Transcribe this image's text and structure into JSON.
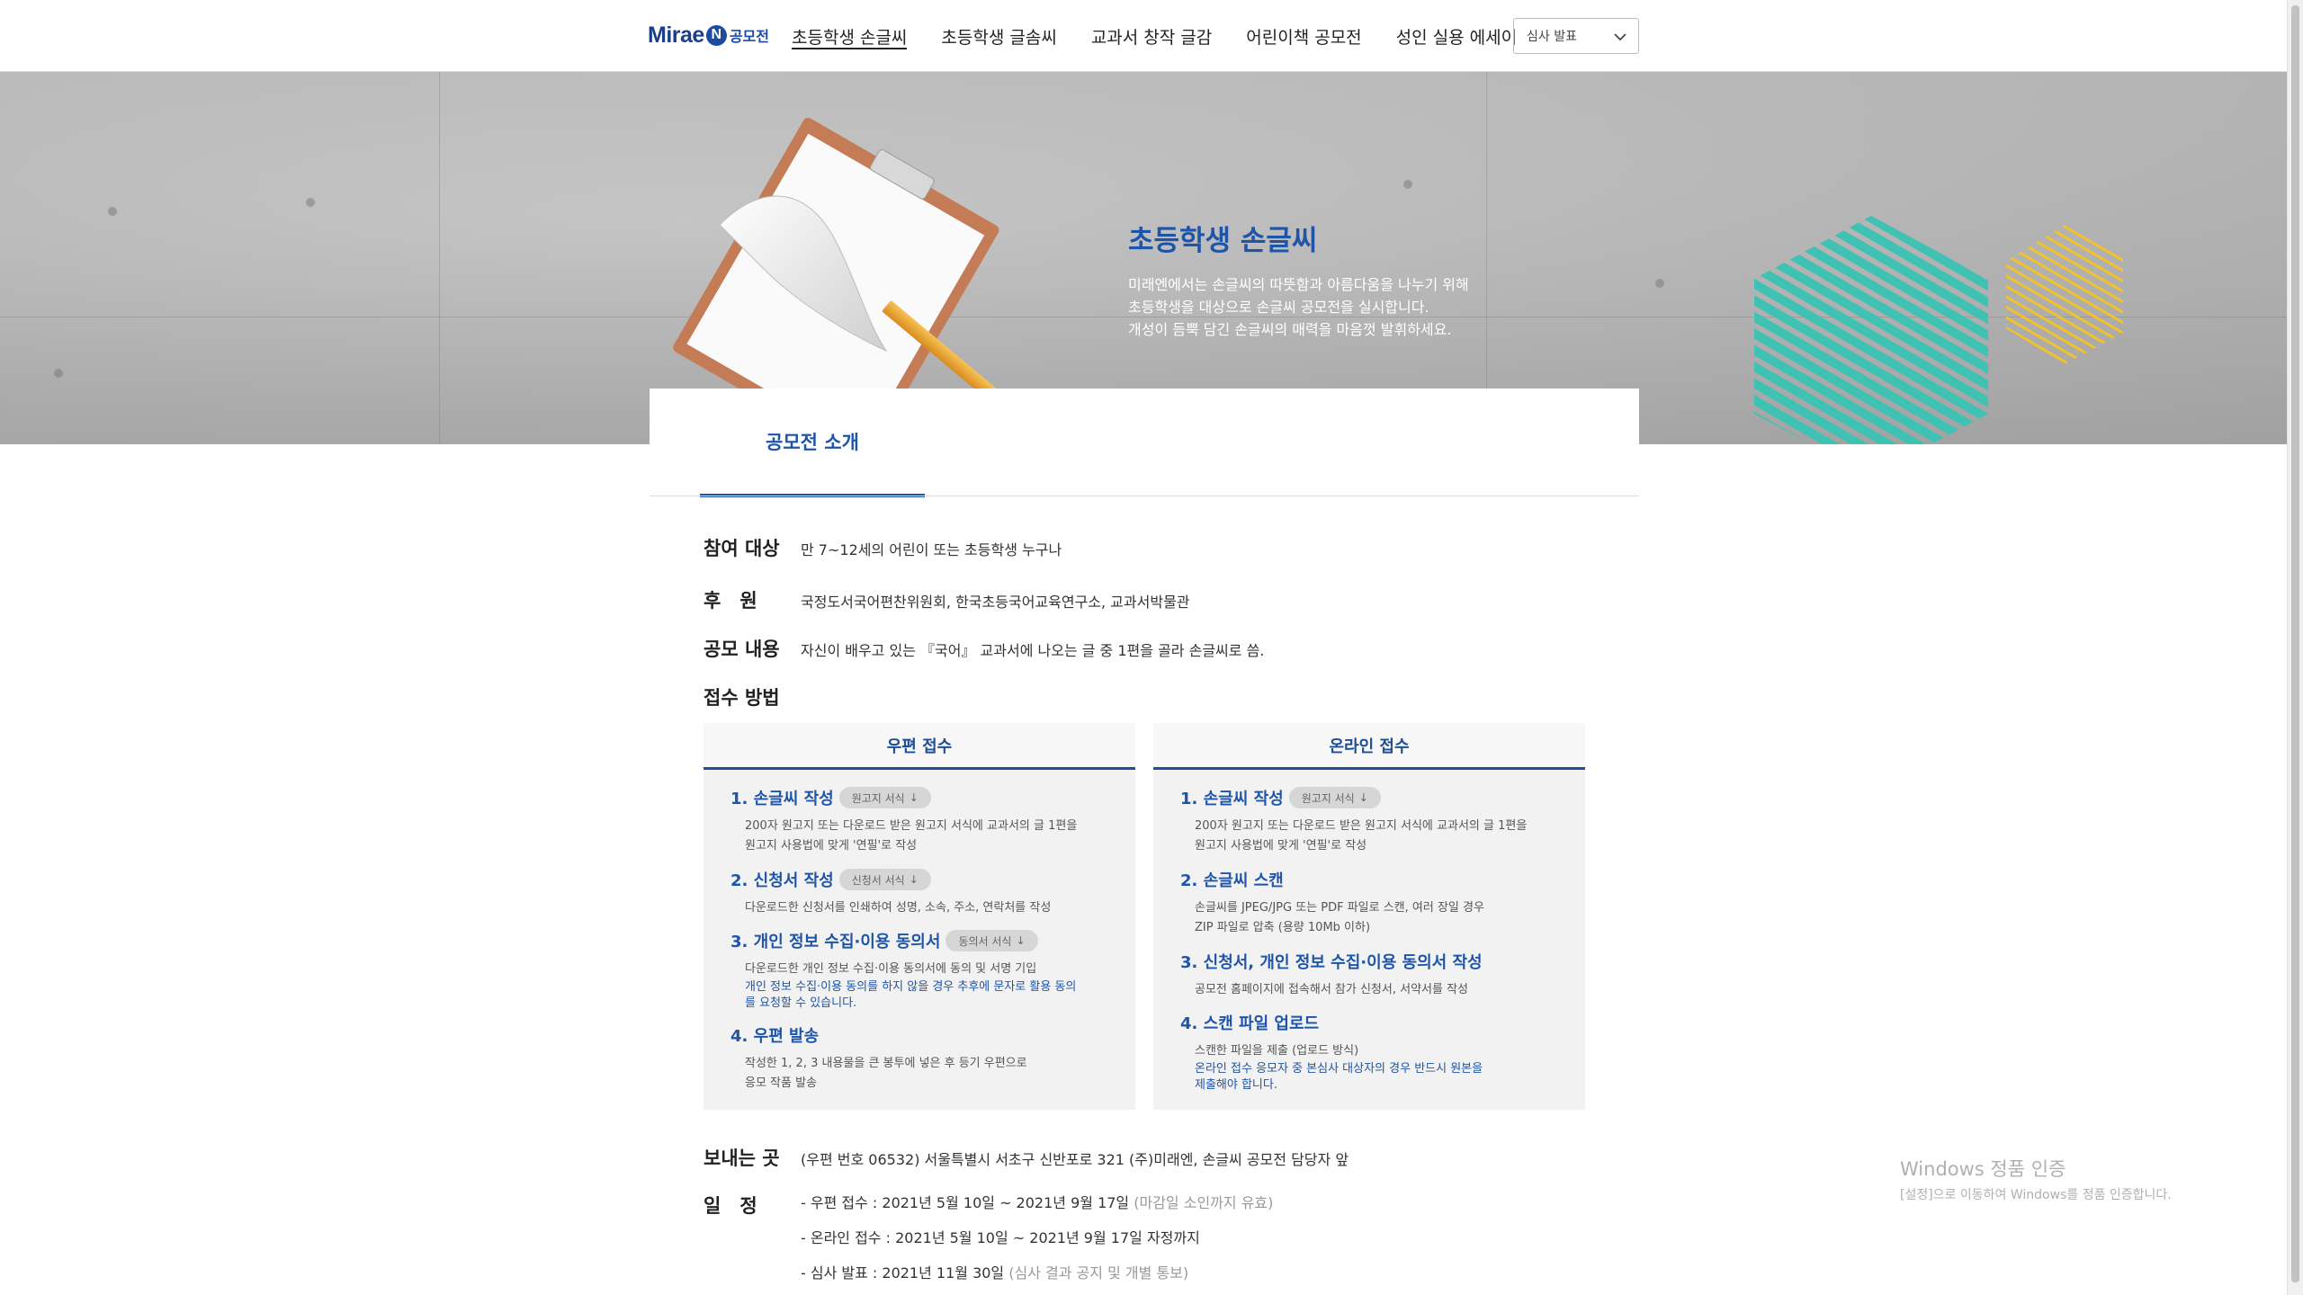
{
  "header": {
    "logo_word": "Mirae",
    "logo_mark": "N",
    "logo_suffix": "공모전",
    "nav": [
      {
        "label": "초등학생 손글씨",
        "active": true
      },
      {
        "label": "초등학생 글솜씨",
        "active": false
      },
      {
        "label": "교과서 창작 글감",
        "active": false
      },
      {
        "label": "어린이책 공모전",
        "active": false
      },
      {
        "label": "성인 실용 에세이",
        "active": false
      }
    ],
    "select_value": "심사 발표",
    "select_icon": "chevron-down-icon"
  },
  "banner": {
    "title": "초등학생 손글씨",
    "desc": [
      "미래엔에서는 손글씨의 따뜻함과 아름다움을 나누기 위해",
      "초등학생을 대상으로 손글씨 공모전을 실시합니다.",
      "개성이 듬뿍 담긴 손글씨의 매력을 마음껏 발휘하세요."
    ],
    "colors": {
      "title": "#1f55a8",
      "teal": "#3fc2b4",
      "yellow": "#f2c22d",
      "navy": "#3c4fa5"
    }
  },
  "tab": {
    "label": "공모전 소개"
  },
  "info": {
    "target_label": "참여 대상",
    "target_text": "만 7~12세의 어린이 또는 초등학생 누구나",
    "sponsor_label": "후　원",
    "sponsor_text": "국정도서국어편찬위원회, 한국초등국어교육연구소, 교과서박물관",
    "content_label": "공모 내용",
    "content_text": "자신이 배우고 있는 『국어』 교과서에 나오는 글 중 1편을 골라 손글씨로 씀.",
    "method_label": "접수 방법",
    "address_label": "보내는 곳",
    "address_text": "(우편 번호 06532) 서울특별시 서초구 신반포로 321 (주)미래엔, 손글씨 공모전 담당자 앞",
    "schedule_label": "일　정",
    "schedule": [
      {
        "text": "- 우편 접수 : 2021년 5월 10일 ~ 2021년 9월 17일",
        "note": " (마감일 소인까지 유효)"
      },
      {
        "text": "- 온라인 접수 : 2021년 5월 10일 ~ 2021년 9월 17일 자정까지",
        "note": ""
      },
      {
        "text": "- 심사 발표 : 2021년 11월 30일",
        "note": " (심사 결과 공지 및 개별 통보)"
      }
    ]
  },
  "mail": {
    "title": "우편 접수",
    "steps": [
      {
        "title": "1. 손글씨 작성",
        "button": "원고지 서식",
        "desc": [
          "200자 원고지 또는 다운로드 받은 원고지 서식에 교과서의 글 1편을",
          "원고지 사용법에 맞게 '연필'로 작성"
        ],
        "note": []
      },
      {
        "title": "2. 신청서 작성",
        "button": "신청서 서식",
        "desc": [
          "다운로드한 신청서를 인쇄하여 성명, 소속, 주소, 연락처를 작성"
        ],
        "note": []
      },
      {
        "title": "3. 개인 정보 수집·이용 동의서",
        "button": "동의서 서식",
        "desc": [
          "다운로드한 개인 정보 수집·이용 동의서에 동의 및 서명 기입"
        ],
        "note": [
          "개인 정보 수집·이용 동의를 하지 않을 경우 추후에 문자로 활용 동의",
          "를 요청할 수 있습니다."
        ]
      },
      {
        "title": "4. 우편 발송",
        "button": "",
        "desc": [
          "작성한 1, 2, 3 내용물을 큰 봉투에 넣은 후 등기 우편으로",
          "응모 작품 발송"
        ],
        "note": []
      }
    ]
  },
  "online": {
    "title": "온라인 접수",
    "steps": [
      {
        "title": "1. 손글씨 작성",
        "button": "원고지 서식",
        "desc": [
          "200자 원고지 또는 다운로드 받은 원고지 서식에 교과서의 글 1편을",
          "원고지 사용법에 맞게 '연필'로 작성"
        ],
        "note": []
      },
      {
        "title": "2. 손글씨 스캔",
        "button": "",
        "desc": [
          "손글씨를 JPEG/JPG 또는 PDF 파일로 스캔, 여러 장일 경우",
          "ZIP 파일로 압축 (용량 10Mb 이하)"
        ],
        "note": []
      },
      {
        "title": "3. 신청서, 개인 정보 수집·이용 동의서 작성",
        "button": "",
        "desc": [
          "공모전 홈페이지에 접속해서 참가 신청서, 서약서를 작성"
        ],
        "note": []
      },
      {
        "title": "4. 스캔 파일 업로드",
        "button": "",
        "desc": [
          "스캔한 파일을 제출 (업로드 방식)"
        ],
        "note": [
          "온라인 접수 응모자 중 본심사 대상자의 경우 반드시 원본을",
          "제출해야 합니다."
        ]
      }
    ]
  },
  "watermark": {
    "title": "Windows 정품 인증",
    "sub": "[설정]으로 이동하여 Windows를 정품 인증합니다."
  }
}
